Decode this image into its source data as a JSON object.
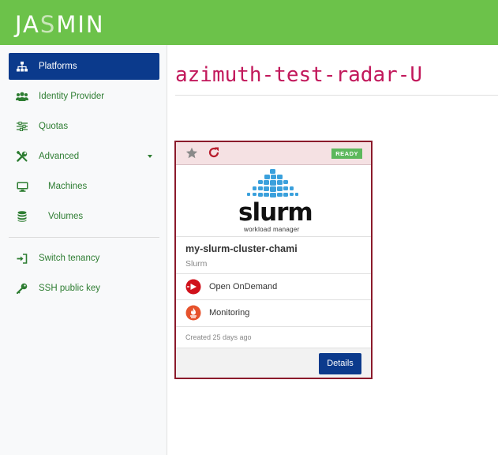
{
  "header": {
    "logo_text_a": "JA",
    "logo_text_b": "S",
    "logo_text_c": "MIN"
  },
  "sidebar": {
    "items": [
      {
        "label": "Platforms",
        "icon": "sitemap-icon",
        "active": true
      },
      {
        "label": "Identity Provider",
        "icon": "users-icon"
      },
      {
        "label": "Quotas",
        "icon": "sliders-icon"
      },
      {
        "label": "Advanced",
        "icon": "tools-icon",
        "expanded": true
      },
      {
        "label": "Machines",
        "icon": "desktop-icon"
      },
      {
        "label": "Volumes",
        "icon": "database-icon"
      },
      {
        "label": "Switch tenancy",
        "icon": "sign-in-icon"
      },
      {
        "label": "SSH public key",
        "icon": "key-icon"
      }
    ]
  },
  "main": {
    "title": "azimuth-test-radar-U"
  },
  "card": {
    "status": "READY",
    "logo_word": "slurm",
    "logo_sub": "workload manager",
    "name": "my-slurm-cluster-chami",
    "type": "Slurm",
    "services": [
      {
        "label": "Open OnDemand",
        "icon": "open-ondemand-icon"
      },
      {
        "label": "Monitoring",
        "icon": "prometheus-icon"
      }
    ],
    "created": "Created 25 days ago",
    "details_label": "Details"
  },
  "colors": {
    "brand_green": "#6cc24a",
    "nav_active": "#0b3a8c",
    "title_pink": "#c2185b",
    "card_border": "#8b1a2b",
    "ready_green": "#5cb85c"
  }
}
